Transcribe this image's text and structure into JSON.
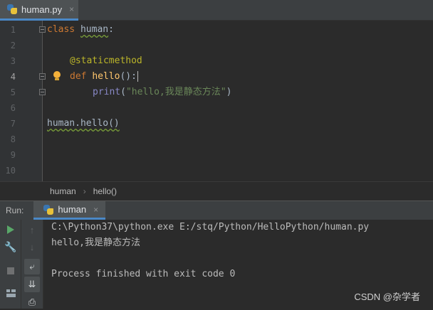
{
  "editor_tab": {
    "filename": "human.py",
    "close_glyph": "×",
    "icon": "python-file-icon"
  },
  "editor": {
    "line_numbers": [
      "1",
      "2",
      "3",
      "4",
      "5",
      "6",
      "7",
      "8",
      "9",
      "10"
    ],
    "code": {
      "l1_kw": "class",
      "l1_name": "human",
      "l1_colon": ":",
      "l3_decorator": "@staticmethod",
      "l4_kw": "def",
      "l4_fn": "hello",
      "l4_rest": "():",
      "l5_builtin": "print",
      "l5_open": "(",
      "l5_str": "\"hello,我是静态方法\"",
      "l5_close": ")",
      "l7_call": "human.hello()"
    },
    "intention_icon": "lightbulb-icon"
  },
  "breadcrumb": {
    "items": [
      "human",
      "hello()"
    ],
    "separator": "›"
  },
  "run_panel": {
    "label": "Run:",
    "tab_label": "human",
    "tab_close": "×",
    "console_lines": [
      "C:\\Python37\\python.exe E:/stq/Python/HelloPython/human.py",
      "hello,我是静态方法",
      "",
      "Process finished with exit code 0"
    ]
  },
  "watermark": "CSDN @杂学者",
  "colors": {
    "accent": "#4a88c7",
    "keyword": "#cc7832",
    "decorator": "#bbb529",
    "function": "#ffc66d",
    "string": "#6a8759",
    "run_green": "#59a869"
  }
}
